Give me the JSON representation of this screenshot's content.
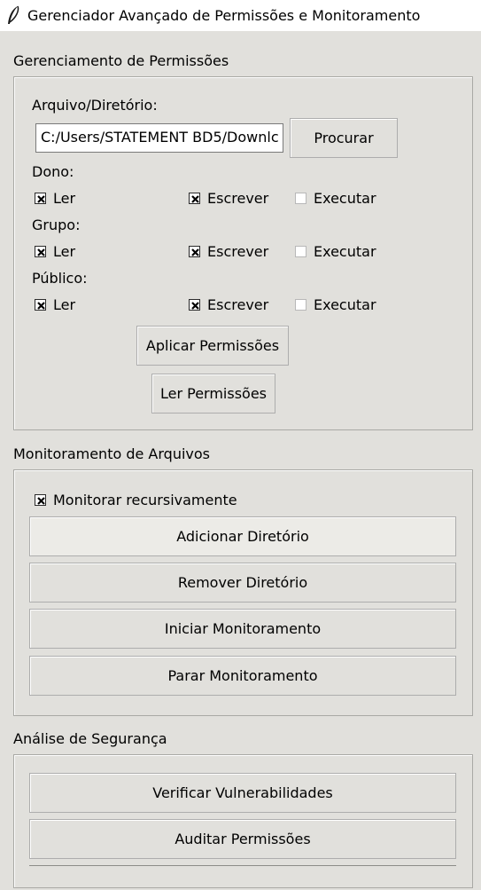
{
  "window": {
    "title": "Gerenciador Avançado de Permissões e Monitoramento",
    "icon": "feather-icon"
  },
  "permissions": {
    "section_label": "Gerenciamento de Permissões",
    "path_label": "Arquivo/Diretório:",
    "path_value": "C:/Users/STATEMENT BD5/Downlc",
    "browse_label": "Procurar",
    "groups": [
      {
        "label": "Dono:",
        "read": "Ler",
        "write": "Escrever",
        "execute": "Executar",
        "read_checked": true,
        "write_checked": true,
        "execute_checked": false
      },
      {
        "label": "Grupo:",
        "read": "Ler",
        "write": "Escrever",
        "execute": "Executar",
        "read_checked": true,
        "write_checked": true,
        "execute_checked": false
      },
      {
        "label": "Público:",
        "read": "Ler",
        "write": "Escrever",
        "execute": "Executar",
        "read_checked": true,
        "write_checked": true,
        "execute_checked": false
      }
    ],
    "apply_label": "Aplicar Permissões",
    "read_perms_label": "Ler Permissões"
  },
  "monitoring": {
    "section_label": "Monitoramento de Arquivos",
    "recursive_label": "Monitorar recursivamente",
    "recursive_checked": true,
    "add_label": "Adicionar Diretório",
    "remove_label": "Remover Diretório",
    "start_label": "Iniciar Monitoramento",
    "stop_label": "Parar Monitoramento"
  },
  "security": {
    "section_label": "Análise de Segurança",
    "check_label": "Verificar Vulnerabilidades",
    "audit_label": "Auditar Permissões"
  }
}
